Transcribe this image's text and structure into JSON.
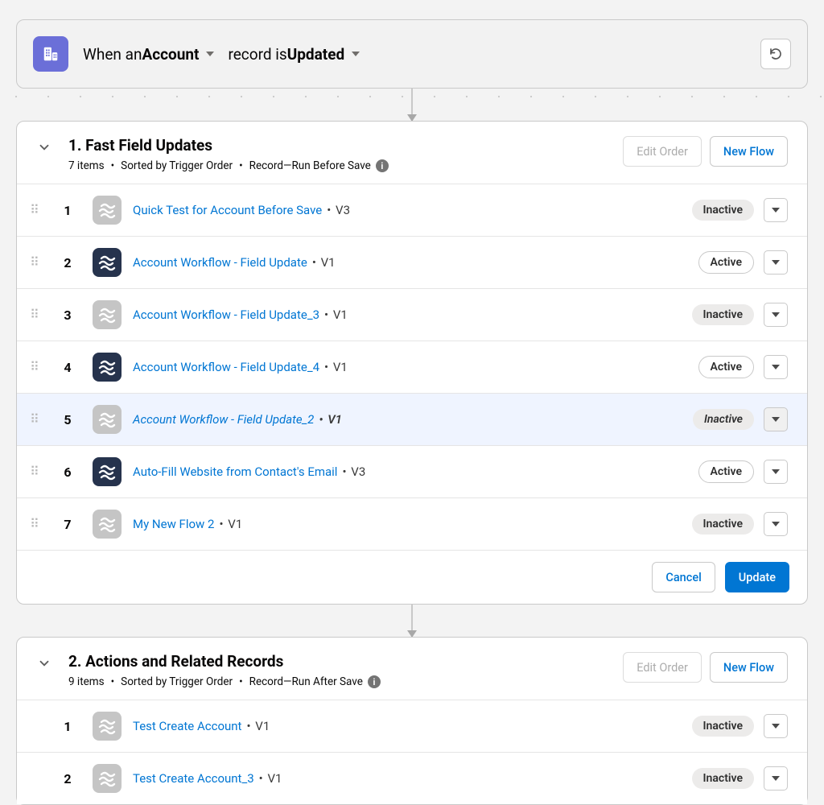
{
  "trigger": {
    "prefix": "When an ",
    "object": "Account ",
    "mid": "record is ",
    "event": "Updated ",
    "refresh_icon": "↻"
  },
  "buttons": {
    "edit_order": "Edit Order",
    "new_flow": "New Flow",
    "cancel": "Cancel",
    "update": "Update"
  },
  "sections": [
    {
      "title": "1. Fast Field Updates",
      "sub_items": "7 items",
      "sub_sort": "Sorted by Trigger Order",
      "sub_type": "Record—Run Before Save",
      "show_footer": true,
      "show_drag": true,
      "edit_order_disabled": true,
      "rows": [
        {
          "order": "1",
          "name": "Quick Test for Account Before Save",
          "version": "V3",
          "status": "Inactive",
          "active": false,
          "selected": false
        },
        {
          "order": "2",
          "name": "Account Workflow - Field Update",
          "version": "V1",
          "status": "Active",
          "active": true,
          "selected": false
        },
        {
          "order": "3",
          "name": "Account Workflow - Field Update_3",
          "version": "V1",
          "status": "Inactive",
          "active": false,
          "selected": false
        },
        {
          "order": "4",
          "name": "Account Workflow - Field Update_4",
          "version": "V1",
          "status": "Active",
          "active": true,
          "selected": false
        },
        {
          "order": "5",
          "name": "Account Workflow - Field Update_2",
          "version": "V1",
          "status": "Inactive",
          "active": false,
          "selected": true
        },
        {
          "order": "6",
          "name": "Auto-Fill Website from Contact's Email",
          "version": "V3",
          "status": "Active",
          "active": true,
          "selected": false
        },
        {
          "order": "7",
          "name": "My New Flow 2",
          "version": "V1",
          "status": "Inactive",
          "active": false,
          "selected": false
        }
      ]
    },
    {
      "title": "2. Actions and Related Records",
      "sub_items": "9 items",
      "sub_sort": "Sorted by Trigger Order",
      "sub_type": "Record—Run After Save",
      "show_footer": false,
      "show_drag": false,
      "edit_order_disabled": true,
      "rows": [
        {
          "order": "1",
          "name": "Test Create Account",
          "version": "V1",
          "status": "Inactive",
          "active": false,
          "selected": false
        },
        {
          "order": "2",
          "name": "Test Create Account_3",
          "version": "V1",
          "status": "Inactive",
          "active": false,
          "selected": false
        }
      ]
    }
  ]
}
